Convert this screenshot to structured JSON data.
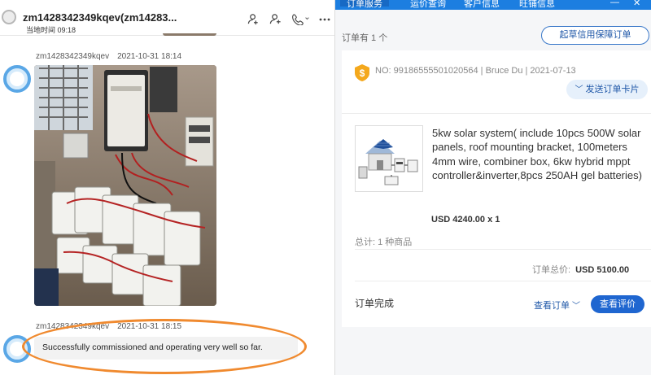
{
  "chat": {
    "header": {
      "title": "zm1428342349kqev(zm14283...",
      "local_time": "当地时间 09:18"
    },
    "messages": [
      {
        "sender": "zm1428342349kqev",
        "time": "2021-10-31 18:14",
        "type": "image"
      },
      {
        "sender": "zm1428342349kqev",
        "time": "2021-10-31 18:15",
        "type": "text",
        "text": "Successfully commissioned and operating very well so far."
      }
    ]
  },
  "order_panel": {
    "tabs": [
      "订单服务",
      "运价查询",
      "客户信息",
      "旺铺信息"
    ],
    "active_tab": 0,
    "window_controls": [
      "minimize-icon",
      "close-icon"
    ],
    "order_count": "订单有 1 个",
    "draft_button": "起草信用保障订单",
    "card": {
      "order_no": "NO: 99186555501020564 | Bruce Du | 2021-07-13",
      "send_card_button": "发送订单卡片",
      "product": {
        "title": "5kw solar system( include 10pcs 500W solar panels, roof mounting bracket, 100meters 4mm wire, combiner box, 6kw hybrid mppt controller&inverter,8pcs 250AH gel batteries)",
        "price": "USD 4240.00 x 1"
      },
      "total_items": "总计: 1 种商品",
      "order_total_label": "订单总价:",
      "order_total_value": "USD 5100.00",
      "status": "订单完成",
      "view_order_button": "查看订单",
      "view_review_button": "查看评价"
    }
  },
  "colors": {
    "brand_blue": "#1c7ee0",
    "button_blue": "#1f66d0",
    "highlight_orange": "#f08a2f",
    "avatar_blue": "#5aa7e6"
  },
  "icons": {
    "header": [
      "user-add-icon",
      "contact-icon",
      "phone-icon",
      "more-icon"
    ],
    "order": "shield-badge-icon"
  }
}
